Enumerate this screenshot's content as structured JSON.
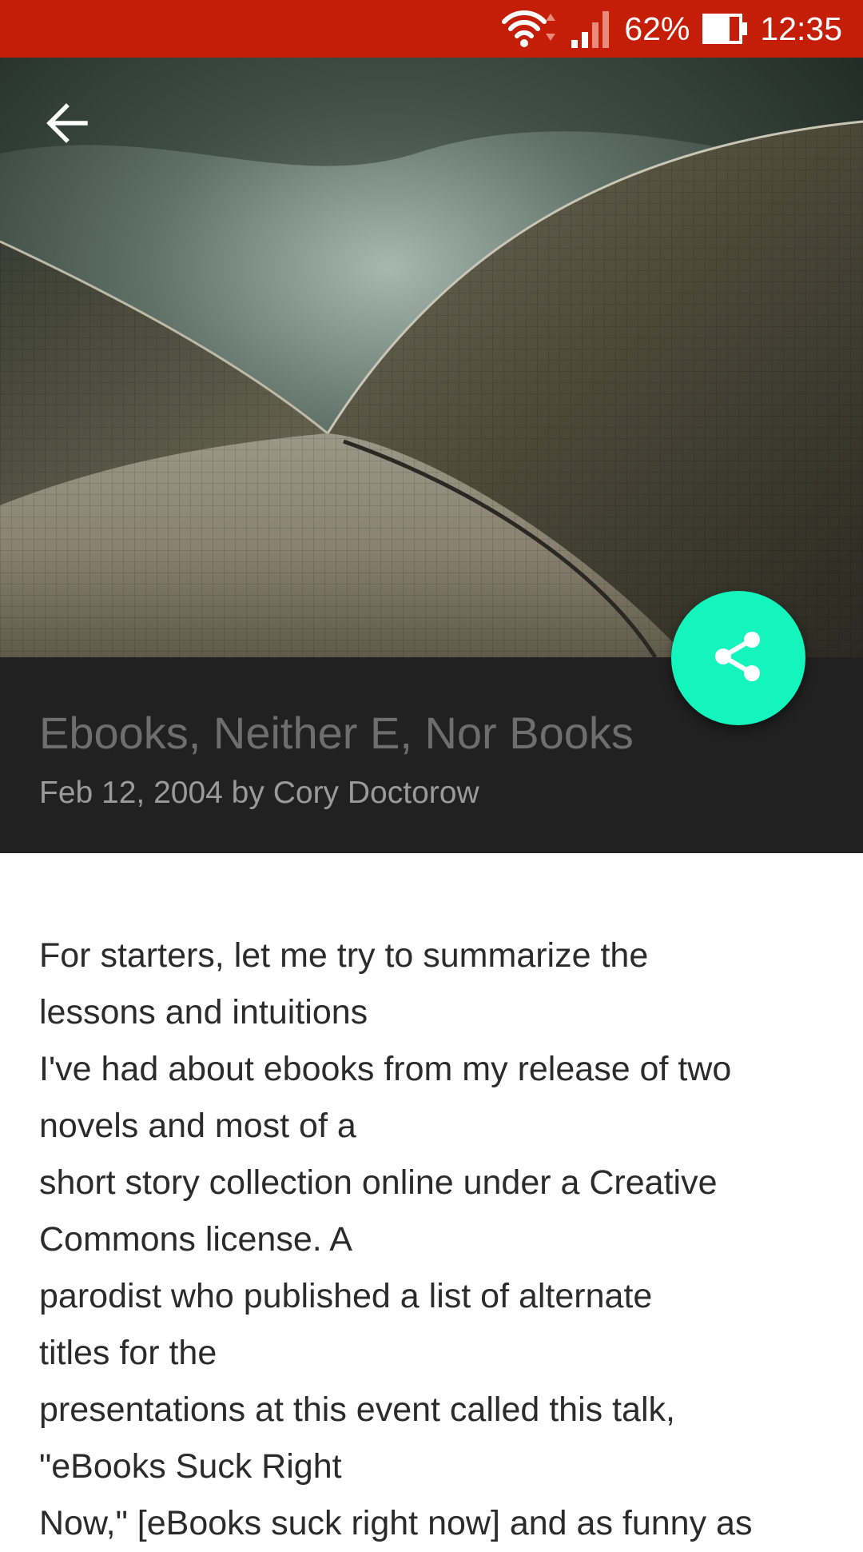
{
  "status_bar": {
    "battery": "62%",
    "time": "12:35",
    "icons": [
      "wifi-icon",
      "signal-icon",
      "battery-icon"
    ],
    "color": "#c41e08"
  },
  "header": {
    "back_icon": "arrow-left-icon",
    "hero_image": "sydney-opera-house-shells-photo"
  },
  "article": {
    "title": "Ebooks, Neither E, Nor Books",
    "byline": "Feb 12, 2004 by Cory Doctorow",
    "paragraph_lines": [
      "For starters, let me try to summarize the",
      "lessons and intuitions",
      "I've had about ebooks from my release of two",
      "novels and most of a",
      "short story collection online under a Creative",
      "Commons license. A",
      "parodist who published a list of alternate",
      "titles for the",
      "presentations at this event called this talk,",
      "\"eBooks Suck Right",
      "Now,\" [eBooks suck right now] and as funny as"
    ]
  },
  "share_button": {
    "icon": "share-icon",
    "color": "#14f5be"
  }
}
